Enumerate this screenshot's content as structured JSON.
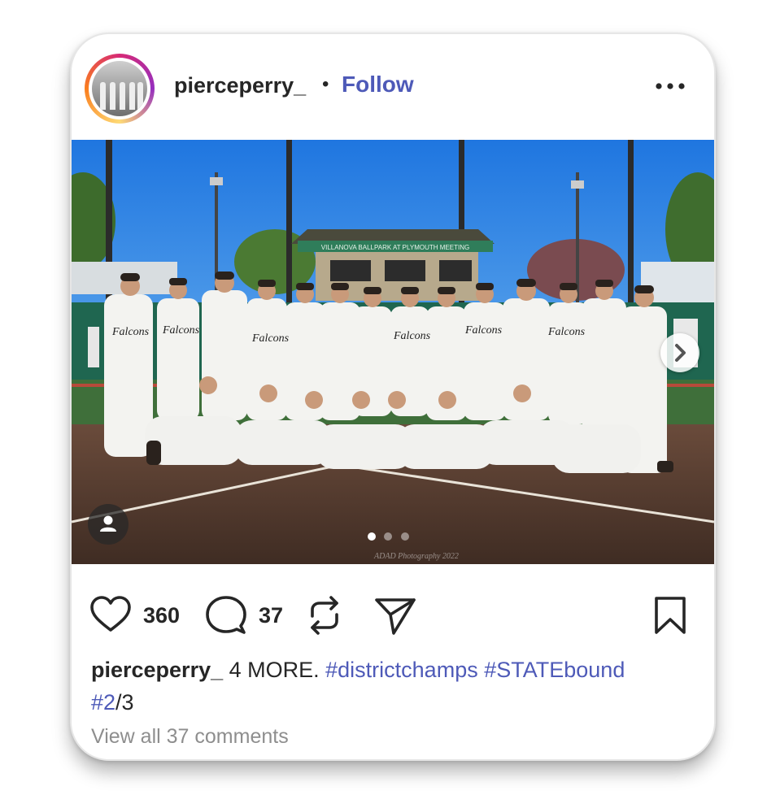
{
  "post": {
    "username": "pierceperry_",
    "separator": "•",
    "follow_label": "Follow",
    "media": {
      "scoreboard_text": "VILLANOVA BALLPARK AT PLYMOUTH MEETING",
      "jersey_team_name": "Falcons",
      "watermark": "ADAD Photography 2022",
      "carousel_count": 3,
      "carousel_active_index": 0
    },
    "likes_count": "360",
    "comments_count": "37",
    "caption": {
      "username": "pierceperry_",
      "text": " 4 MORE. ",
      "hashtags": [
        "#districtchamps",
        "#STATEbound",
        "#2"
      ],
      "suffix": "/3"
    },
    "view_all_comments": "View all 37 comments"
  },
  "icons": {
    "more": "more-horizontal-icon",
    "like": "heart-icon",
    "comment": "comment-bubble-icon",
    "repost": "repost-icon",
    "share": "send-icon",
    "save": "bookmark-icon",
    "next": "chevron-right-icon",
    "tag": "user-tag-icon"
  },
  "colors": {
    "link_blue": "#4e5ab8",
    "text": "#262626",
    "muted": "#8e8e8e",
    "sky": "#2f86e6",
    "field": "#3f6f3a",
    "dirt": "#5b4033"
  }
}
